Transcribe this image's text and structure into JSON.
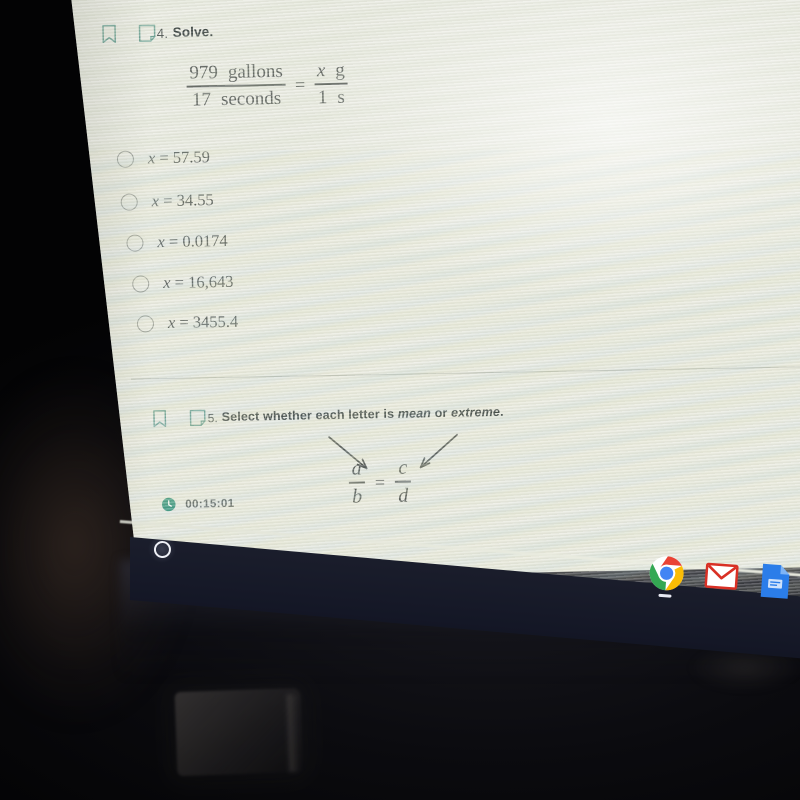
{
  "question4": {
    "number": "4.",
    "title": "Solve.",
    "bookmark_icon": "bookmark-icon",
    "note_icon": "note-icon",
    "equation": {
      "left_numerator_value": "979",
      "left_numerator_unit": "gallons",
      "left_denominator_value": "17",
      "left_denominator_unit": "seconds",
      "equals": "=",
      "right_numerator_value": "x",
      "right_numerator_unit": "g",
      "right_denominator_value": "1",
      "right_denominator_unit": "s"
    },
    "options": [
      {
        "id": "opt-a",
        "variable": "x",
        "equals": "=",
        "value": "57.59",
        "selected": false
      },
      {
        "id": "opt-b",
        "variable": "x",
        "equals": "=",
        "value": "34.55",
        "selected": false
      },
      {
        "id": "opt-c",
        "variable": "x",
        "equals": "=",
        "value": "0.0174",
        "selected": false
      },
      {
        "id": "opt-d",
        "variable": "x",
        "equals": "=",
        "value": "16,643",
        "selected": false
      },
      {
        "id": "opt-e",
        "variable": "x",
        "equals": "=",
        "value": "3455.4",
        "selected": false
      }
    ]
  },
  "question5": {
    "number": "5.",
    "title_plain_1": "Select whether each letter is ",
    "title_italic_1": "mean",
    "title_plain_2": " or ",
    "title_italic_2": "extreme",
    "title_plain_3": ".",
    "bookmark_icon": "bookmark-icon",
    "note_icon": "note-icon",
    "proportion": {
      "left_numerator": "a",
      "left_denominator": "b",
      "equals": "=",
      "right_numerator": "c",
      "right_denominator": "d"
    },
    "annotations": [
      {
        "name": "arrow-to-a",
        "description": "hand-drawn arrow pointing down-right to the letter a"
      },
      {
        "name": "arrow-to-c",
        "description": "hand-drawn arrow pointing down-left to the letter c"
      }
    ]
  },
  "timer": {
    "icon": "clock-icon",
    "value": "00:15:01"
  },
  "shelf": {
    "launcher_label": "launcher-circle",
    "apps": [
      {
        "name": "chrome",
        "label": "Google Chrome",
        "running": true
      },
      {
        "name": "gmail",
        "label": "Gmail",
        "running": false
      },
      {
        "name": "slides",
        "label": "Google Slides",
        "running": false
      }
    ]
  },
  "colors": {
    "accent_teal": "#3f8f7f",
    "page_background": "#eaebe2",
    "text_dark": "#222b2b",
    "shelf": "#161a28",
    "chrome_blue": "#4285f4",
    "chrome_red": "#ea4335",
    "chrome_yellow": "#fbbc05",
    "chrome_green": "#34a853",
    "gmail_red": "#d93025",
    "slides_blue": "#1a73e8"
  }
}
